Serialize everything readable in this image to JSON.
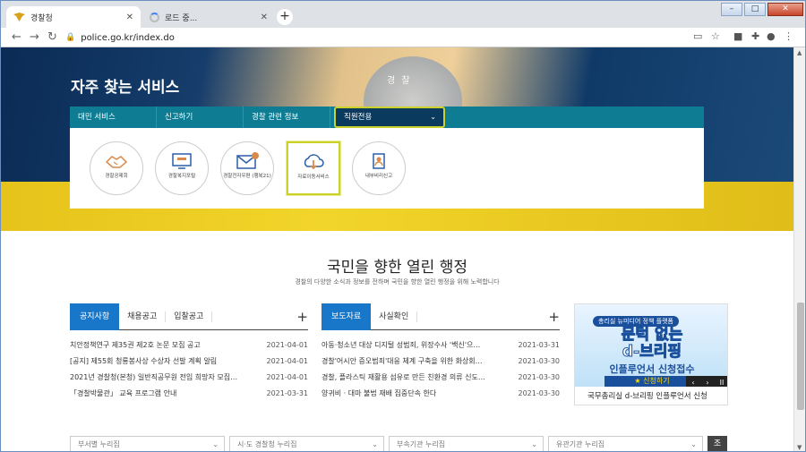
{
  "browser": {
    "tabs": [
      {
        "title": "경찰청"
      },
      {
        "title": "로드 중..."
      }
    ],
    "new_tab_label": "+",
    "url": "police.go.kr/index.do",
    "window_controls": {
      "minimize": "–",
      "maximize": "□",
      "close": "✕"
    }
  },
  "hero": {
    "badge_text": "경 찰",
    "title": "자주 찾는 서비스",
    "service_tabs": [
      "대민 서비스",
      "신고하기",
      "경찰 관련 정보",
      "직원전용"
    ],
    "selected_tab": "직원전용",
    "services": [
      {
        "label": "경찰공제회",
        "icon": "handshake-icon"
      },
      {
        "label": "경찰복지포털",
        "icon": "monitor-icon"
      },
      {
        "label": "경찰전자우편 (행복21)",
        "icon": "mail-icon"
      },
      {
        "label": "자료이동서비스",
        "icon": "cloud-download-icon"
      },
      {
        "label": "내부비리신고",
        "icon": "user-report-icon"
      }
    ]
  },
  "main": {
    "heading": "국민을 향한 열린 행정",
    "subheading": "경찰의 다양한 소식과 정보를 전하며 국민을 향한 열린 행정을 위해 노력합니다",
    "notice_box": {
      "tabs": [
        "공지사항",
        "채용공고",
        "입찰공고"
      ],
      "active": "공지사항",
      "more": "+",
      "items": [
        {
          "title": "치안정책연구 제35권 제2호 논문 모집 공고",
          "date": "2021-04-01"
        },
        {
          "title": "[공지] 제55회 청룡봉사상 수상자 선발 계획 알림",
          "date": "2021-04-01"
        },
        {
          "title": "2021년 경찰청(본청) 일반직공무원 전입 희망자 모집…",
          "date": "2021-04-01"
        },
        {
          "title": "「경찰박물관」 교육 프로그램 안내",
          "date": "2021-03-31"
        }
      ]
    },
    "press_box": {
      "tabs": [
        "보도자료",
        "사실확인"
      ],
      "active": "보도자료",
      "more": "+",
      "items": [
        {
          "title": "아동·청소년 대상 디지털 성범죄, 위장수사 '백신'으…",
          "date": "2021-03-31"
        },
        {
          "title": "경찰'어시안 증오범죄'대응 체계 구축을 위한 화상회…",
          "date": "2021-03-30"
        },
        {
          "title": "경찰, 플라스틱 재활용 섬유로 만든 친환경 의류 신도…",
          "date": "2021-03-30"
        },
        {
          "title": "양귀비 · 대마 불법 재배 집중단속 한다",
          "date": "2021-03-30"
        }
      ]
    },
    "banner": {
      "line1": "총리실 뉴미디어 정책 플랫폼",
      "line2a": "문턱 없는",
      "line2b": "d-브리핑",
      "line3": "인플루언서 신청접수",
      "cta": "★ 신청하기",
      "caption": "국무총리실 d-브리핑 인플루언서 신청",
      "controls": [
        "‹",
        "›",
        "II"
      ]
    },
    "bottom_selects": [
      "부서별 누리집",
      "시·도 경찰청 누리집",
      "부속기관 누리집",
      "유관기관 누리집"
    ],
    "go_label": "조"
  },
  "colors": {
    "accent": "#1977c9",
    "service_bar": "#0e7d93",
    "highlight": "#cbd32a"
  }
}
